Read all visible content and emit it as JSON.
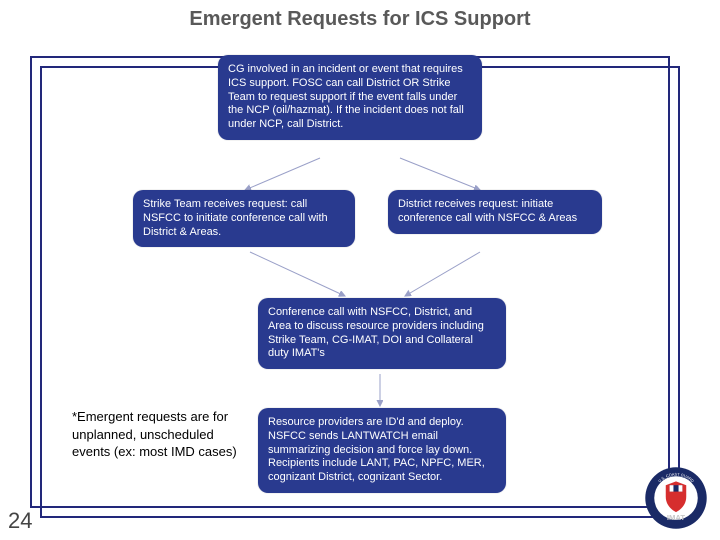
{
  "title": "Emergent Requests for ICS Support",
  "boxes": {
    "top": "CG involved in an incident or event that requires ICS support. FOSC can call District OR Strike Team to request support if the event falls under the NCP (oil/hazmat). If the incident does not fall under NCP, call District.",
    "left": "Strike Team receives request: call NSFCC to initiate conference call with District & Areas.",
    "right": "District receives request: initiate conference call with NSFCC & Areas",
    "conf": "Conference call with NSFCC, District, and Area to discuss resource providers including Strike Team, CG-IMAT, DOI and Collateral duty IMAT's",
    "deploy": "Resource providers are ID'd and deploy. NSFCC sends LANTWATCH email summarizing decision and force lay down. Recipients include LANT, PAC, NPFC, MER, cognizant District, cognizant Sector."
  },
  "note": "*Emergent requests are for unplanned, unscheduled events (ex: most IMD cases)",
  "page_number": "24",
  "logo": {
    "top_label": "U.S. COAST GUARD",
    "mid_label": "IMAT",
    "bottom_label": "INCIDENT MANAGEMENT ASSIST TEAM"
  }
}
